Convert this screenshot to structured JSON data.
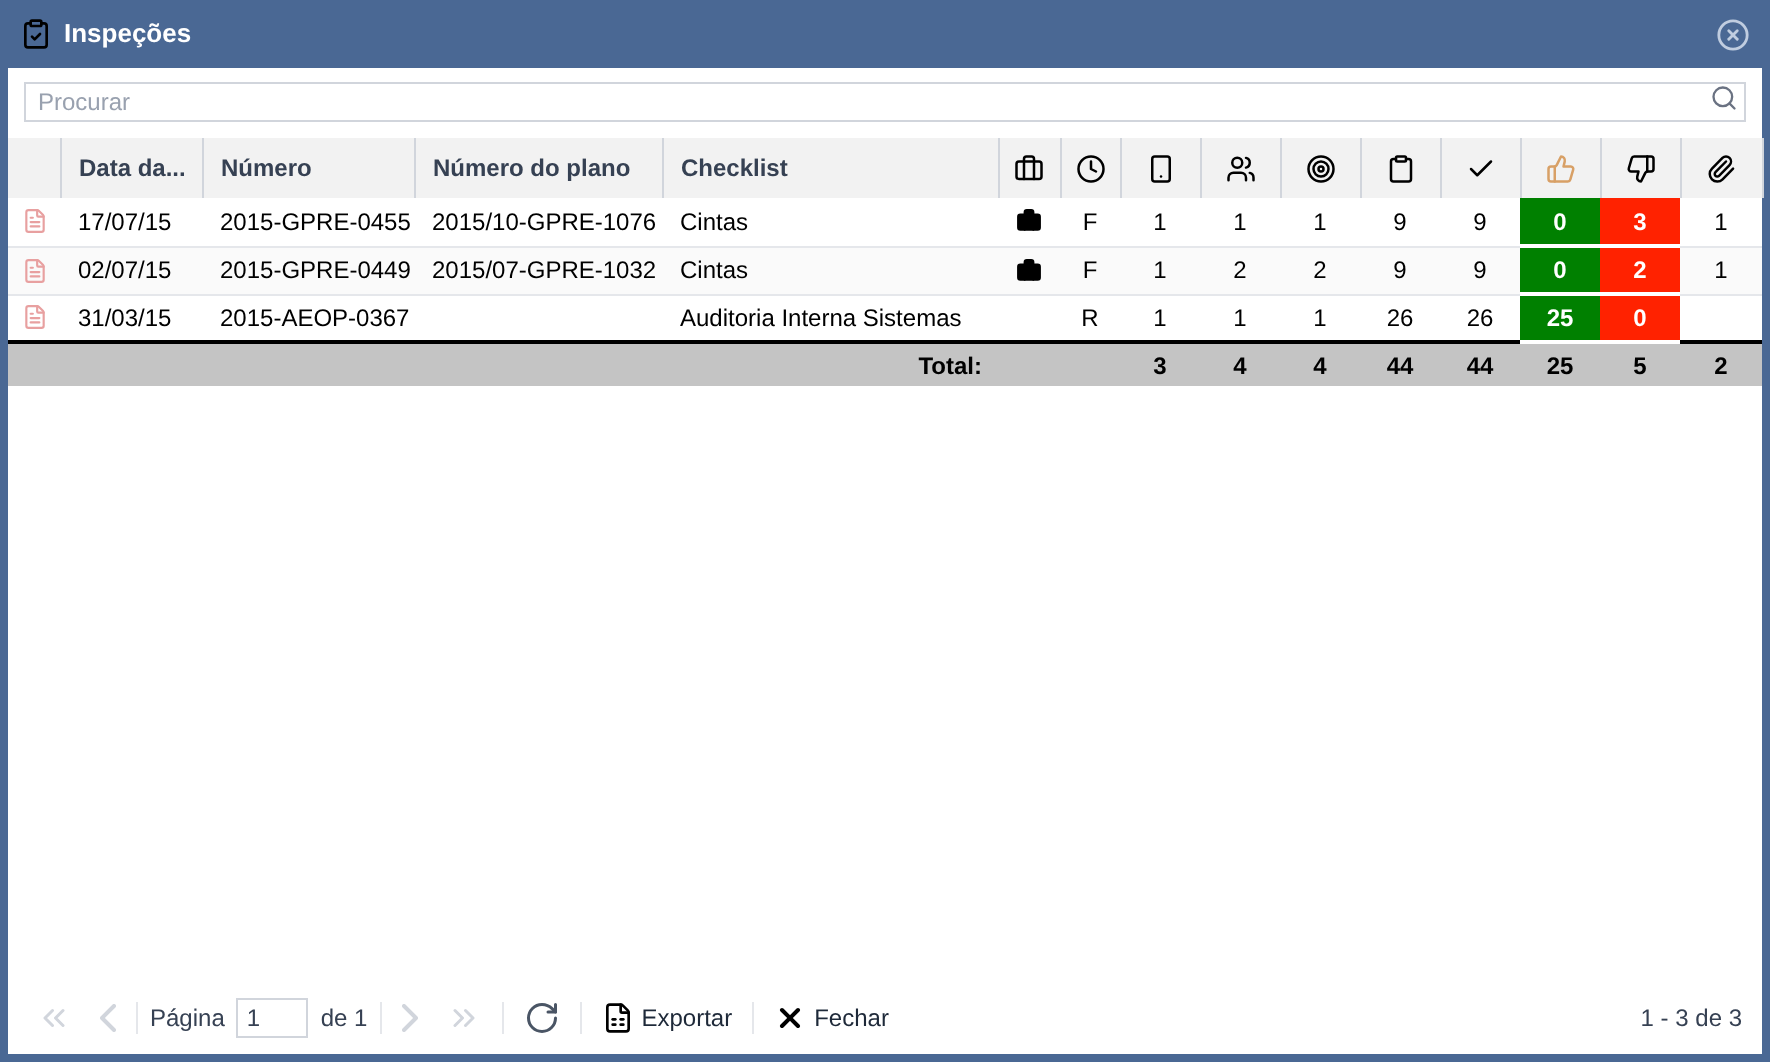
{
  "window": {
    "title": "Inspeções"
  },
  "search": {
    "placeholder": "Procurar"
  },
  "table": {
    "columns": [
      "Data da...",
      "Número",
      "Número do plano",
      "Checklist"
    ],
    "rows": [
      {
        "date": "17/07/15",
        "number": "2015-GPRE-0455",
        "plan": "2015/10-GPRE-1076",
        "checklist": "Cintas",
        "briefcase": true,
        "type": "F",
        "c1": "1",
        "c2": "1",
        "c3": "1",
        "c4": "9",
        "c5": "9",
        "positive": "0",
        "negative": "3",
        "attachments": "1"
      },
      {
        "date": "02/07/15",
        "number": "2015-GPRE-0449",
        "plan": "2015/07-GPRE-1032",
        "checklist": "Cintas",
        "briefcase": true,
        "type": "F",
        "c1": "1",
        "c2": "2",
        "c3": "2",
        "c4": "9",
        "c5": "9",
        "positive": "0",
        "negative": "2",
        "attachments": "1"
      },
      {
        "date": "31/03/15",
        "number": "2015-AEOP-0367",
        "checklist": "Auditoria Interna Sistemas",
        "briefcase": false,
        "type": "R",
        "c1": "1",
        "c2": "1",
        "c3": "1",
        "c4": "26",
        "c5": "26",
        "positive": "25",
        "negative": "0"
      }
    ],
    "total": {
      "label": "Total:",
      "values": [
        "3",
        "4",
        "4",
        "44",
        "44",
        "25",
        "5",
        "2"
      ]
    }
  },
  "pager": {
    "first_disabled": true,
    "prev_disabled": true,
    "page_label": "Página",
    "page": "1",
    "of": "de 1",
    "next_disabled": true,
    "last_disabled": true,
    "export": "Exportar",
    "close": "Fechar",
    "range": "1 - 3 de 3"
  }
}
